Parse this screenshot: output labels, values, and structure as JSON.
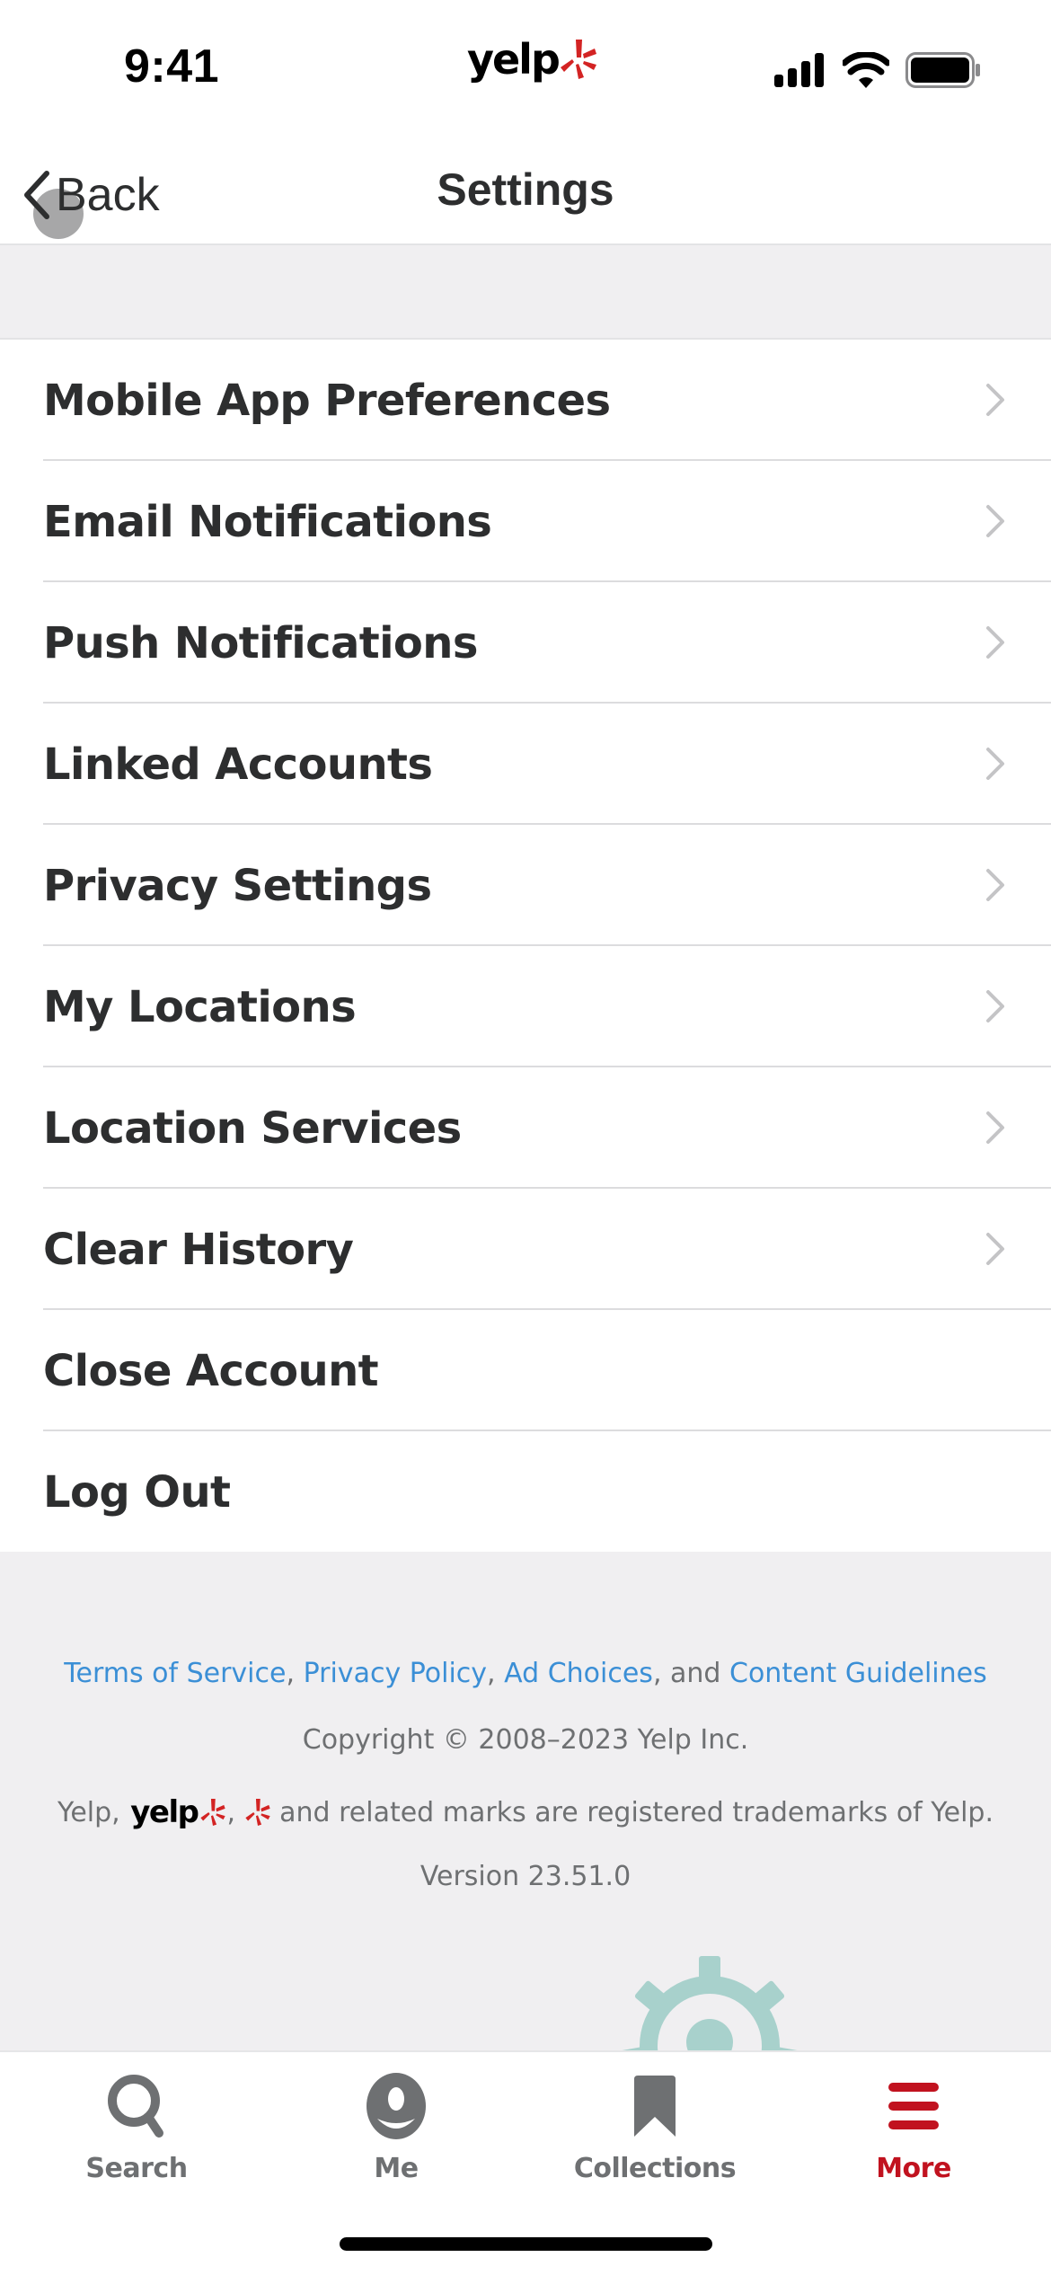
{
  "status_bar": {
    "time": "9:41",
    "logo_text": "yelp",
    "logo_icon": "yelp-burst-icon",
    "icons": [
      "cellular-signal-icon",
      "wifi-icon",
      "battery-icon"
    ]
  },
  "nav": {
    "back_label": "Back",
    "back_icon": "chevron-left-icon",
    "title": "Settings"
  },
  "settings": {
    "items": [
      {
        "label": "Mobile App Preferences",
        "has_chevron": true
      },
      {
        "label": "Email Notifications",
        "has_chevron": true
      },
      {
        "label": "Push Notifications",
        "has_chevron": true
      },
      {
        "label": "Linked Accounts",
        "has_chevron": true
      },
      {
        "label": "Privacy Settings",
        "has_chevron": true
      },
      {
        "label": "My Locations",
        "has_chevron": true
      },
      {
        "label": "Location Services",
        "has_chevron": true
      },
      {
        "label": "Clear History",
        "has_chevron": true
      },
      {
        "label": "Close Account",
        "has_chevron": false
      },
      {
        "label": "Log Out",
        "has_chevron": false
      }
    ]
  },
  "footer": {
    "links": {
      "terms": "Terms of Service",
      "privacy": "Privacy Policy",
      "ad_choices": "Ad Choices",
      "content_guidelines": "Content Guidelines",
      "sep1": ",",
      "sep2": ",",
      "sep3": ", and"
    },
    "copyright": "Copyright © 2008–2023 Yelp Inc.",
    "trademarks": {
      "prefix": "Yelp,",
      "wordmark": "yelp",
      "sep": ",",
      "suffix": "and related marks are registered trademarks of Yelp."
    },
    "version": "Version 23.51.0",
    "illustration": "gear-icon"
  },
  "tab_bar": {
    "active_color": "#c1121f",
    "inactive_color": "#6e7072",
    "tabs": [
      {
        "label": "Search",
        "icon": "search-icon",
        "active": false
      },
      {
        "label": "Me",
        "icon": "profile-icon",
        "active": false
      },
      {
        "label": "Collections",
        "icon": "bookmark-icon",
        "active": false
      },
      {
        "label": "More",
        "icon": "menu-icon",
        "active": true
      }
    ]
  },
  "colors": {
    "brand_red": "#d32323",
    "link_blue": "#3b8fd6",
    "text_primary": "#2d2e2f",
    "background_gray": "#f0eff1",
    "illustration_teal": "#a8d1cc"
  }
}
